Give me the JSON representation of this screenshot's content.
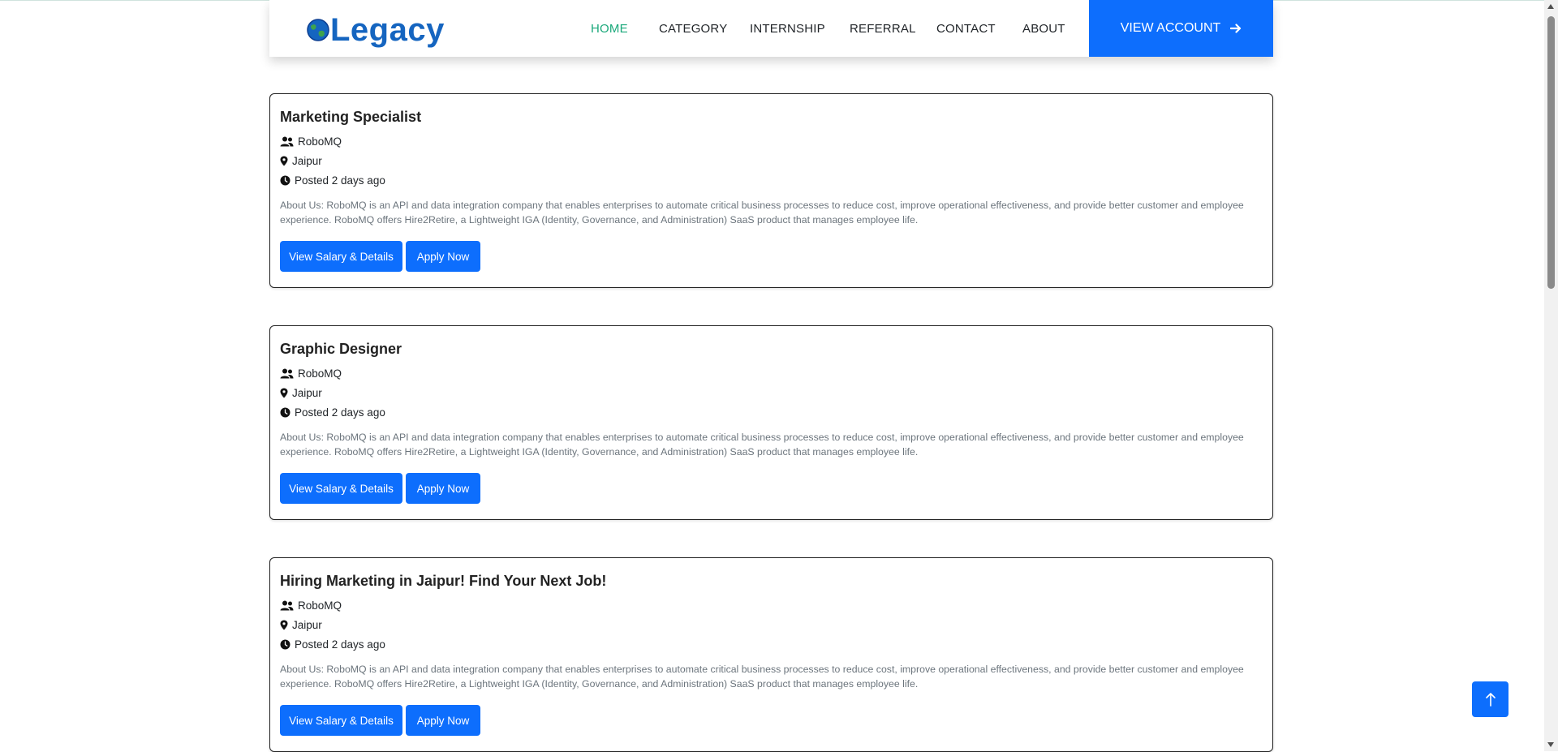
{
  "brand": {
    "name": "Legacy"
  },
  "nav": {
    "items": [
      {
        "label": "HOME",
        "active": true
      },
      {
        "label": "CATEGORY",
        "active": false
      },
      {
        "label": "INTERNSHIP",
        "active": false
      },
      {
        "label": "REFERRAL",
        "active": false
      },
      {
        "label": "CONTACT",
        "active": false
      },
      {
        "label": "ABOUT",
        "active": false
      }
    ],
    "account_label": "VIEW ACCOUNT",
    "account_icon": "arrow-right-icon"
  },
  "jobs": [
    {
      "title": "Marketing Specialist",
      "company": "RoboMQ",
      "location": "Jaipur",
      "posted": "Posted 2 days ago",
      "description": "About Us: RoboMQ is an API and data integration company that enables enterprises to automate critical business processes to reduce cost, improve operational effectiveness, and provide better customer and employee experience. RoboMQ offers Hire2Retire, a Lightweight IGA (Identity, Governance, and Administration) SaaS product that manages employee life.",
      "details_label": "View Salary & Details",
      "apply_label": "Apply Now"
    },
    {
      "title": "Graphic Designer",
      "company": "RoboMQ",
      "location": "Jaipur",
      "posted": "Posted 2 days ago",
      "description": "About Us: RoboMQ is an API and data integration company that enables enterprises to automate critical business processes to reduce cost, improve operational effectiveness, and provide better customer and employee experience. RoboMQ offers Hire2Retire, a Lightweight IGA (Identity, Governance, and Administration) SaaS product that manages employee life.",
      "details_label": "View Salary & Details",
      "apply_label": "Apply Now"
    },
    {
      "title": "Hiring Marketing in Jaipur! Find Your Next Job!",
      "company": "RoboMQ",
      "location": "Jaipur",
      "posted": "Posted 2 days ago",
      "description": "About Us: RoboMQ is an API and data integration company that enables enterprises to automate critical business processes to reduce cost, improve operational effectiveness, and provide better customer and employee experience. RoboMQ offers Hire2Retire, a Lightweight IGA (Identity, Governance, and Administration) SaaS product that manages employee life.",
      "details_label": "View Salary & Details",
      "apply_label": "Apply Now"
    }
  ],
  "colors": {
    "primary": "#0d6efd",
    "nav_active": "#1aa87a",
    "logo": "#1565c0",
    "muted_text": "#6c757d"
  },
  "icons": {
    "company": "users-icon",
    "location": "map-pin-icon",
    "posted": "clock-icon",
    "scroll_top": "arrow-up-icon"
  }
}
